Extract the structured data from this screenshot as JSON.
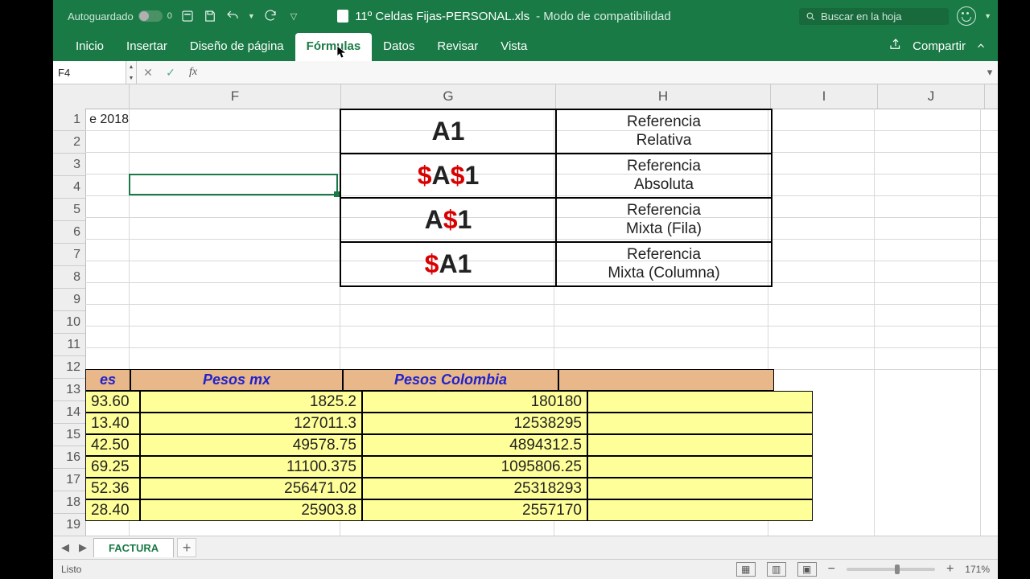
{
  "titlebar": {
    "autosave": "Autoguardado",
    "filename": "11º Celdas Fijas-PERSONAL.xls",
    "mode": " -  Modo de compatibilidad",
    "search_placeholder": "Buscar en la hoja"
  },
  "ribbon": {
    "tabs": [
      "Inicio",
      "Insertar",
      "Diseño de página",
      "Fórmulas",
      "Datos",
      "Revisar",
      "Vista"
    ],
    "active": 3,
    "share": "Compartir"
  },
  "namebox": "F4",
  "columns": [
    "F",
    "G",
    "H",
    "I",
    "J"
  ],
  "rows": [
    "1",
    "2",
    "3",
    "4",
    "5",
    "6",
    "7",
    "8",
    "9",
    "10",
    "11",
    "12",
    "13",
    "14",
    "15",
    "16",
    "17",
    "18",
    "19"
  ],
  "cellE1": "e 2018",
  "ref": [
    {
      "g_pre": "",
      "g_a": "A",
      "g_mid": "",
      "g_one": "1",
      "h1": "Referencia",
      "h2": "Relativa"
    },
    {
      "g_pre": "$",
      "g_a": "A",
      "g_mid": "$",
      "g_one": "1",
      "h1": "Referencia",
      "h2": "Absoluta"
    },
    {
      "g_pre": "",
      "g_a": "A",
      "g_mid": "$",
      "g_one": "1",
      "h1": "Referencia",
      "h2": "Mixta (Fila)"
    },
    {
      "g_pre": "$",
      "g_a": "A",
      "g_mid": "",
      "g_one": "1",
      "h1": "Referencia",
      "h2": "Mixta (Columna)"
    }
  ],
  "table": {
    "headE": "es",
    "headF": "Pesos mx",
    "headG": "Pesos Colombia",
    "rows": [
      {
        "e": "93.60",
        "f": "1825.2",
        "g": "180180"
      },
      {
        "e": "13.40",
        "f": "127011.3",
        "g": "12538295"
      },
      {
        "e": "42.50",
        "f": "49578.75",
        "g": "4894312.5"
      },
      {
        "e": "69.25",
        "f": "11100.375",
        "g": "1095806.25"
      },
      {
        "e": "52.36",
        "f": "256471.02",
        "g": "25318293"
      },
      {
        "e": "28.40",
        "f": "25903.8",
        "g": "2557170"
      }
    ]
  },
  "sheet": {
    "name": "FACTURA"
  },
  "status": {
    "ready": "Listo",
    "zoom": "171%"
  }
}
